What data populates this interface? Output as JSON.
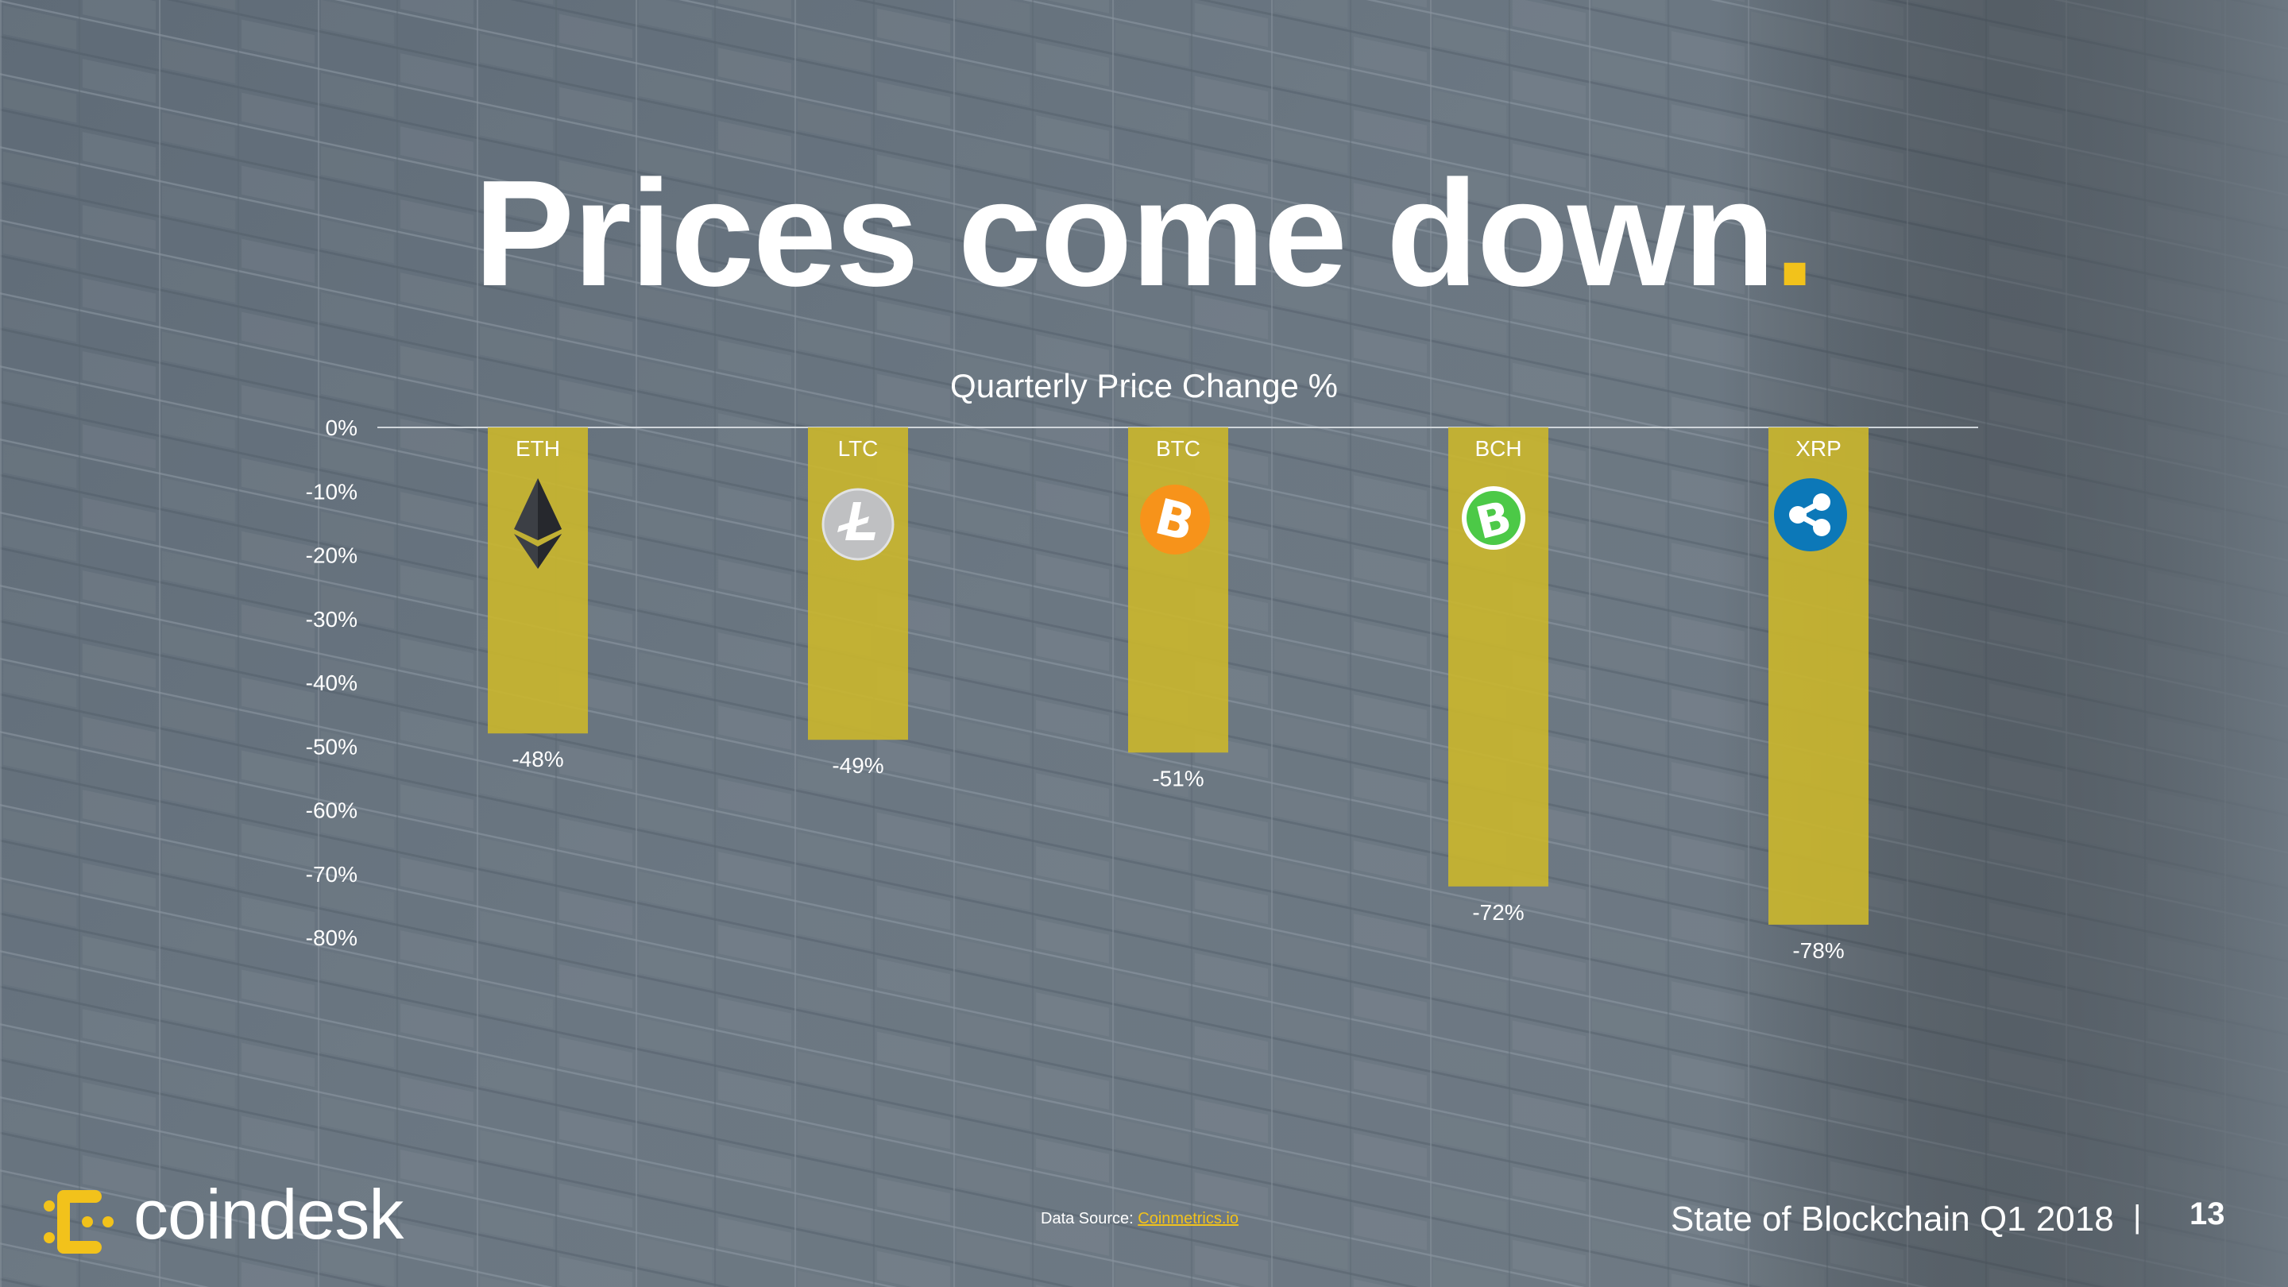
{
  "slide": {
    "title": "Prices come down",
    "title_dot": ".",
    "footer": {
      "source_label": "Data Source: ",
      "source_link": "Coinmetrics.io",
      "report": "State of Blockchain Q1 2018",
      "separator": "|",
      "page": "13"
    },
    "logo_text": "coindesk"
  },
  "colors": {
    "accent": "#f2c21b",
    "bar": "#c9b52e",
    "text": "#ffffff"
  },
  "chart_data": {
    "type": "bar",
    "title": "Quarterly Price Change %",
    "categories": [
      "ETH",
      "LTC",
      "BTC",
      "BCH",
      "XRP"
    ],
    "values": [
      -48,
      -49,
      -51,
      -72,
      -78
    ],
    "value_labels": [
      "-48%",
      "-49%",
      "-51%",
      "-72%",
      "-78%"
    ],
    "icons": [
      "ethereum-icon",
      "litecoin-icon",
      "bitcoin-icon",
      "bitcoin-cash-icon",
      "ripple-icon"
    ],
    "ylim": [
      -80,
      0
    ],
    "yticks": [
      0,
      -10,
      -20,
      -30,
      -40,
      -50,
      -60,
      -70,
      -80
    ],
    "ytick_labels": [
      "0%",
      "-10%",
      "-20%",
      "-30%",
      "-40%",
      "-50%",
      "-60%",
      "-70%",
      "-80%"
    ],
    "grid": false,
    "legend": "none"
  }
}
